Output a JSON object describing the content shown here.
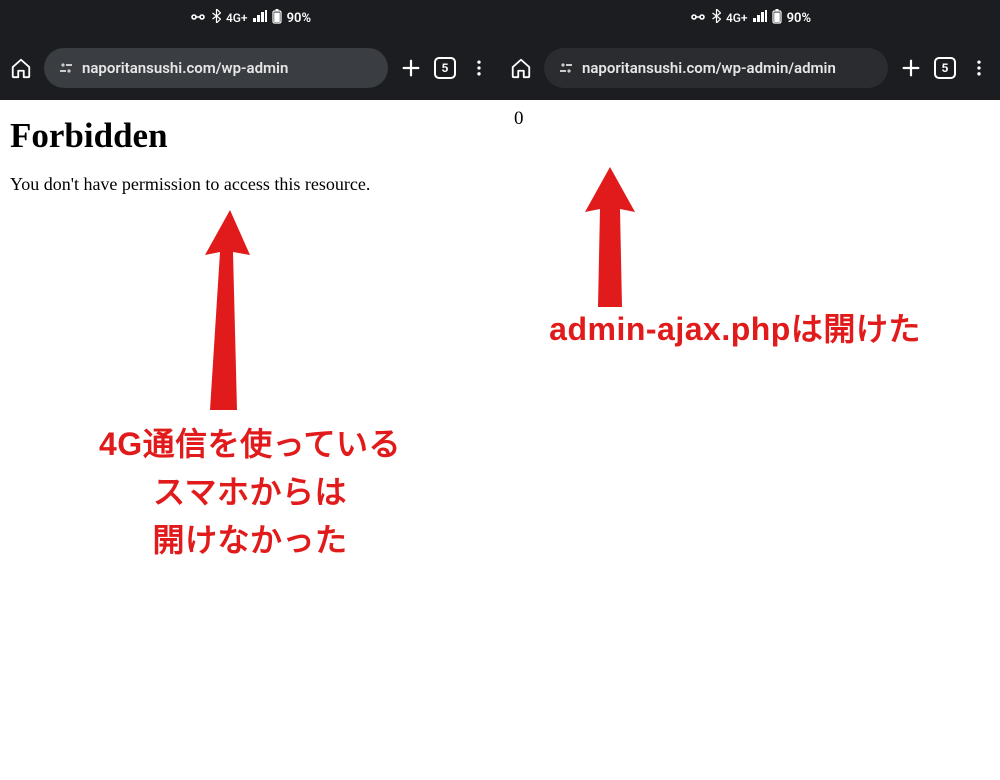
{
  "left": {
    "status": {
      "network": "4G+",
      "battery": "90%"
    },
    "browser": {
      "url": "naporitansushi.com/wp-admin",
      "tab_count": "5"
    },
    "page": {
      "heading": "Forbidden",
      "message": "You don't have permission to access this resource."
    }
  },
  "right": {
    "status": {
      "network": "4G+",
      "battery": "90%"
    },
    "browser": {
      "url": "naporitansushi.com/wp-admin/admin",
      "tab_count": "5"
    },
    "page": {
      "body": "0"
    }
  },
  "annotations": {
    "left_text_line1": "4G通信を使っている",
    "left_text_line2": "スマホからは",
    "left_text_line3": "開けなかった",
    "right_text": "admin-ajax.phpは開けた"
  },
  "colors": {
    "annotation": "#e11b1b",
    "topbar": "#1b1d21",
    "pill": "#3a3d42"
  }
}
